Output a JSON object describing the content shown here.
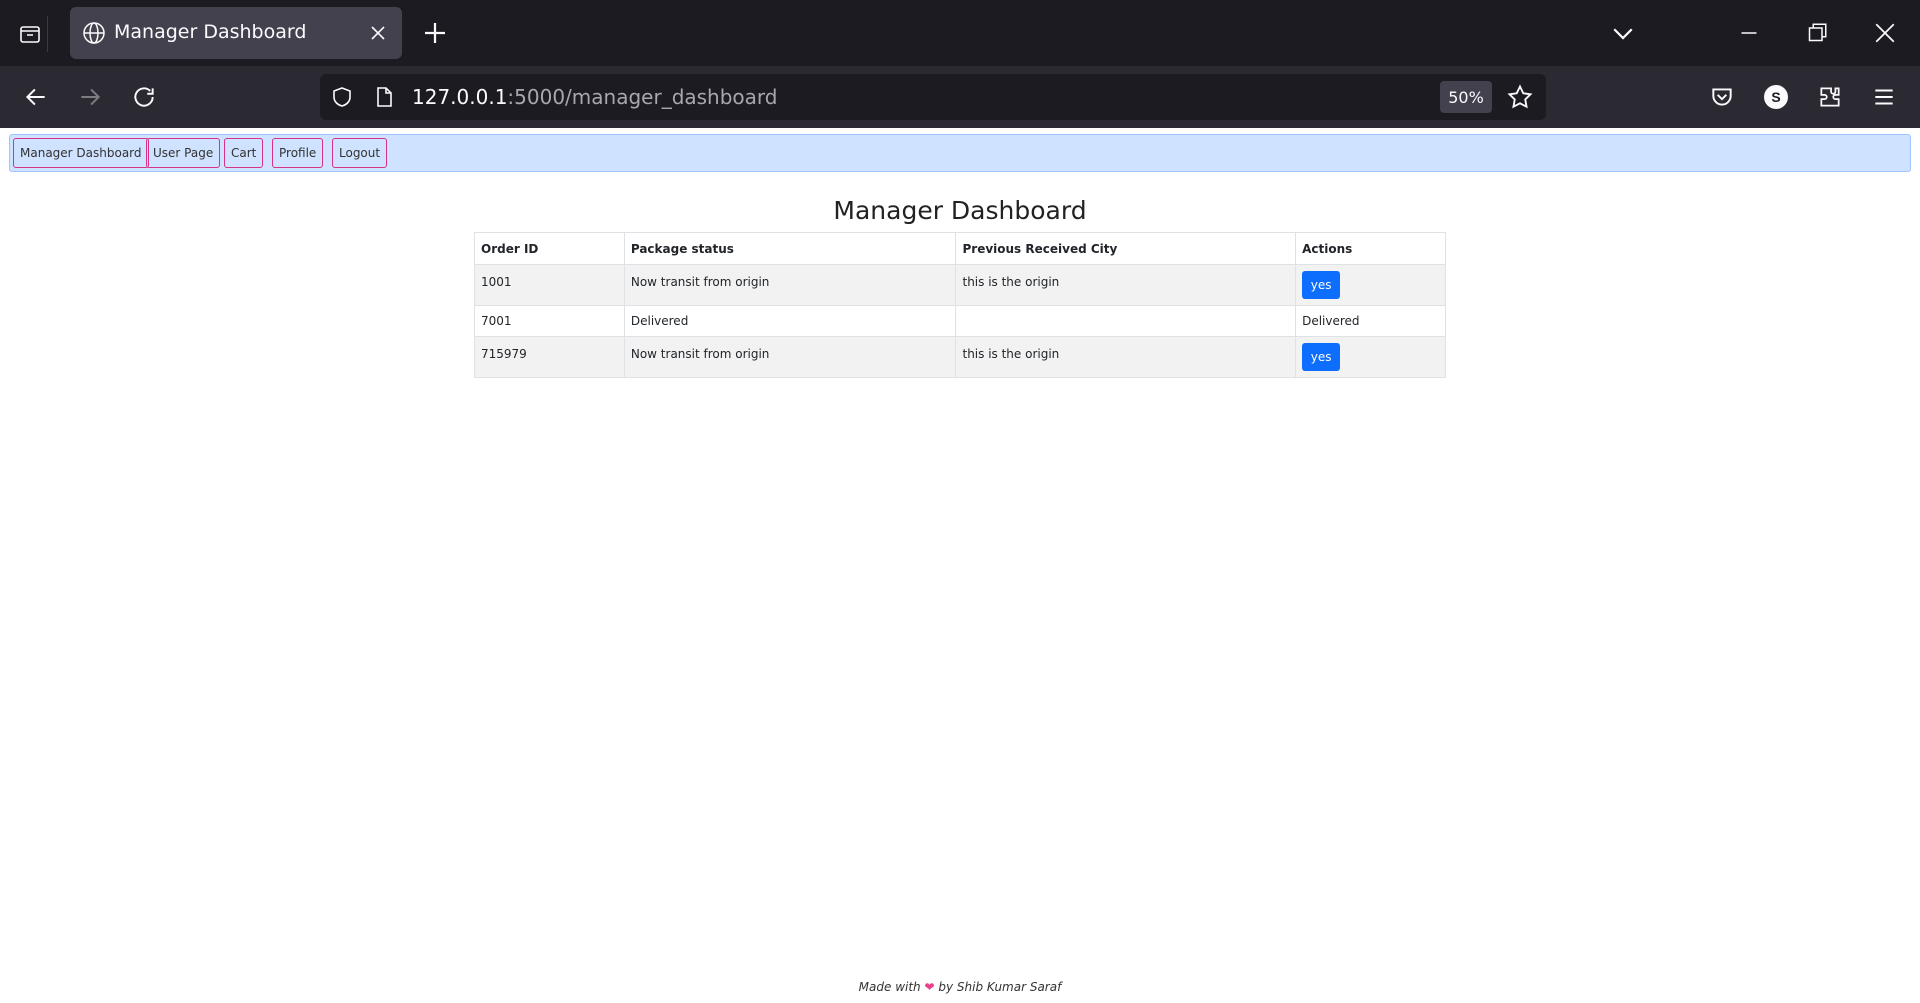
{
  "browser": {
    "tab_title": "Manager Dashboard",
    "url_host": "127.0.0.1",
    "url_path": ":5000/manager_dashboard",
    "zoom": "50%",
    "profile_initial": "S"
  },
  "nav": {
    "items": [
      "Manager Dashboard",
      "User Page",
      "Cart",
      "Profile",
      "Logout"
    ]
  },
  "main": {
    "title": "Manager Dashboard",
    "columns": [
      "Order ID",
      "Package status",
      "Previous Received City",
      "Actions"
    ],
    "rows": [
      {
        "order_id": "1001",
        "status": "Now transit from origin",
        "city": "this is the origin",
        "action": "yes"
      },
      {
        "order_id": "7001",
        "status": "Delivered",
        "city": "",
        "action": "Delivered"
      },
      {
        "order_id": "715979",
        "status": "Now transit from origin",
        "city": "this is the origin",
        "action": "yes"
      }
    ]
  },
  "footer": {
    "prefix": "Made with",
    "heart": "❤",
    "suffix": "by Shib Kumar Saraf"
  }
}
